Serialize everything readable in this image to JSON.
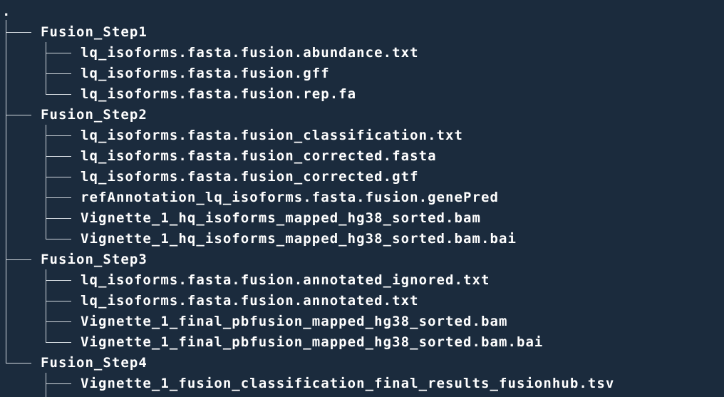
{
  "tree": {
    "root": ".",
    "folders": [
      {
        "name": "Fusion_Step1",
        "files": [
          "lq_isoforms.fasta.fusion.abundance.txt",
          "lq_isoforms.fasta.fusion.gff",
          "lq_isoforms.fasta.fusion.rep.fa"
        ]
      },
      {
        "name": "Fusion_Step2",
        "files": [
          "lq_isoforms.fasta.fusion_classification.txt",
          "lq_isoforms.fasta.fusion_corrected.fasta",
          "lq_isoforms.fasta.fusion_corrected.gtf",
          "refAnnotation_lq_isoforms.fasta.fusion.genePred",
          "Vignette_1_hq_isoforms_mapped_hg38_sorted.bam",
          "Vignette_1_hq_isoforms_mapped_hg38_sorted.bam.bai"
        ]
      },
      {
        "name": "Fusion_Step3",
        "files": [
          "lq_isoforms.fasta.fusion.annotated_ignored.txt",
          "lq_isoforms.fasta.fusion.annotated.txt",
          "Vignette_1_final_pbfusion_mapped_hg38_sorted.bam",
          "Vignette_1_final_pbfusion_mapped_hg38_sorted.bam.bai"
        ]
      },
      {
        "name": "Fusion_Step4",
        "files": [
          "Vignette_1_fusion_classification_final_results_fusionhub.tsv"
        ]
      }
    ]
  }
}
